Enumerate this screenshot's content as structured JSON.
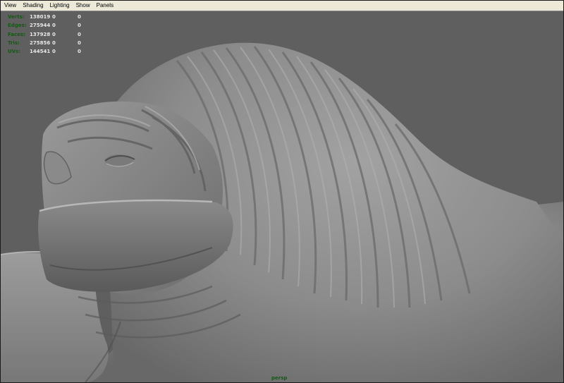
{
  "menubar": {
    "items": [
      "View",
      "Shading",
      "Lighting",
      "Show",
      "Panels"
    ]
  },
  "hud": {
    "rows": [
      {
        "label": "Verts:",
        "total": "138019",
        "selected": "0",
        "component": "0"
      },
      {
        "label": "Edges:",
        "total": "275944",
        "selected": "0",
        "component": "0"
      },
      {
        "label": "Faces:",
        "total": "137928",
        "selected": "0",
        "component": "0"
      },
      {
        "label": "Tris:",
        "total": "275856",
        "selected": "0",
        "component": "0"
      },
      {
        "label": "UVs:",
        "total": "144541",
        "selected": "0",
        "component": "0"
      }
    ]
  },
  "viewport": {
    "camera": "persp",
    "background_color": "#5f5f5f",
    "model_color": "#8e8e8e"
  },
  "colors": {
    "hud_label": "#125a12",
    "hud_value": "#e8e8e8",
    "menubar_bg": "#ece9d8"
  }
}
